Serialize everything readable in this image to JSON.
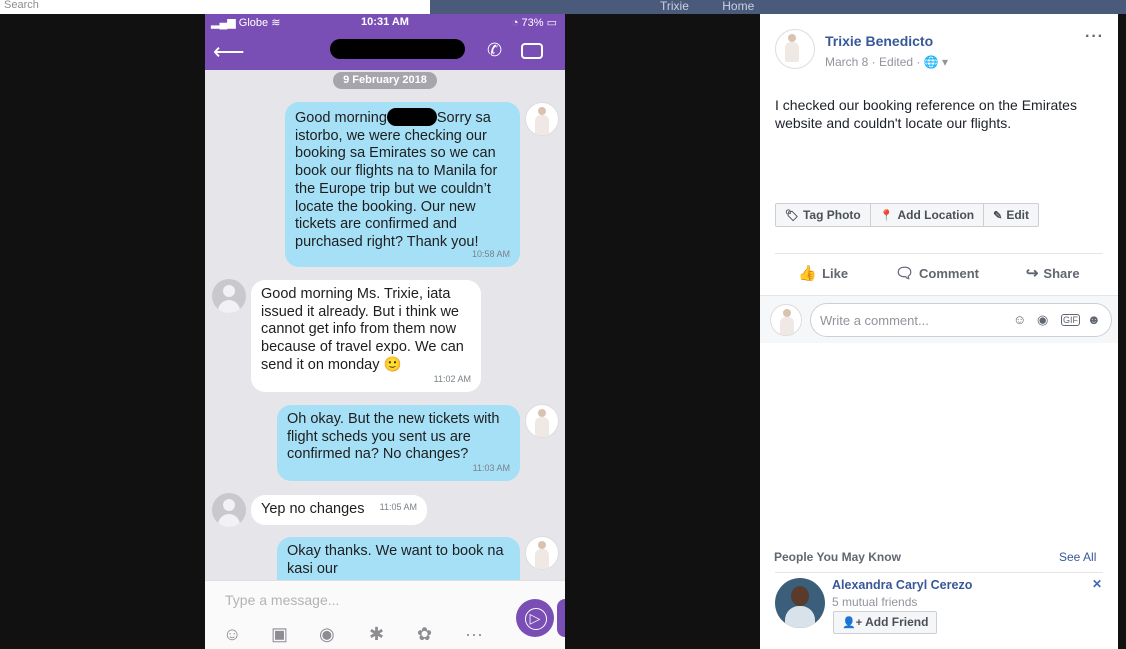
{
  "browser": {
    "search_placeholder": "Search",
    "nav_profile": "Trixie",
    "nav_home": "Home"
  },
  "phone": {
    "status": {
      "carrier": "Globe",
      "time": "10:31 AM",
      "battery": "73%"
    },
    "date_separator": "9 February 2018",
    "messages": [
      {
        "dir": "out",
        "text_before": "Good morning",
        "text_after": "Sorry sa istorbo, we were checking our booking sa Emirates so we can book our flights na to Manila for the Europe trip but we couldn’t locate the booking. Our new tickets are confirmed and purchased right? Thank you!",
        "time": "10:58 AM"
      },
      {
        "dir": "in",
        "text": "Good morning Ms. Trixie, iata issued it already. But i think we cannot get info from them now because of travel expo. We can send it on monday 🙂",
        "time": "11:02 AM"
      },
      {
        "dir": "out",
        "text": "Oh okay. But the new tickets with flight scheds you sent us are confirmed na? No changes?",
        "time": "11:03 AM"
      },
      {
        "dir": "in",
        "text": "Yep no changes",
        "time": "11:05 AM"
      },
      {
        "dir": "out",
        "text": "Okay thanks. We want to book na kasi our",
        "time": ""
      }
    ],
    "composer_placeholder": "Type a message...",
    "toolbar_icons": [
      "sticker-icon",
      "gallery-icon",
      "camera-icon",
      "doodle-icon",
      "gif-icon",
      "more-icon"
    ]
  },
  "post": {
    "author": "Trixie Benedicto",
    "meta": "March 8 · Edited · 🌐 ▾",
    "text": "I checked our booking reference on the Emirates website and couldn't locate our flights.",
    "photo_actions": {
      "tag": "Tag Photo",
      "location": "Add Location",
      "edit": "Edit"
    },
    "actions": {
      "like": "Like",
      "comment": "Comment",
      "share": "Share"
    },
    "comment_placeholder": "Write a comment...",
    "pymk": {
      "title": "People You May Know",
      "see_all": "See All",
      "name": "Alexandra Caryl Cerezo",
      "mutual": "5 mutual friends",
      "add_friend": "Add Friend"
    }
  },
  "colors": {
    "viber_purple": "#7a4fb5",
    "outgoing_bubble": "#a6e0f6",
    "fb_link": "#385898"
  }
}
